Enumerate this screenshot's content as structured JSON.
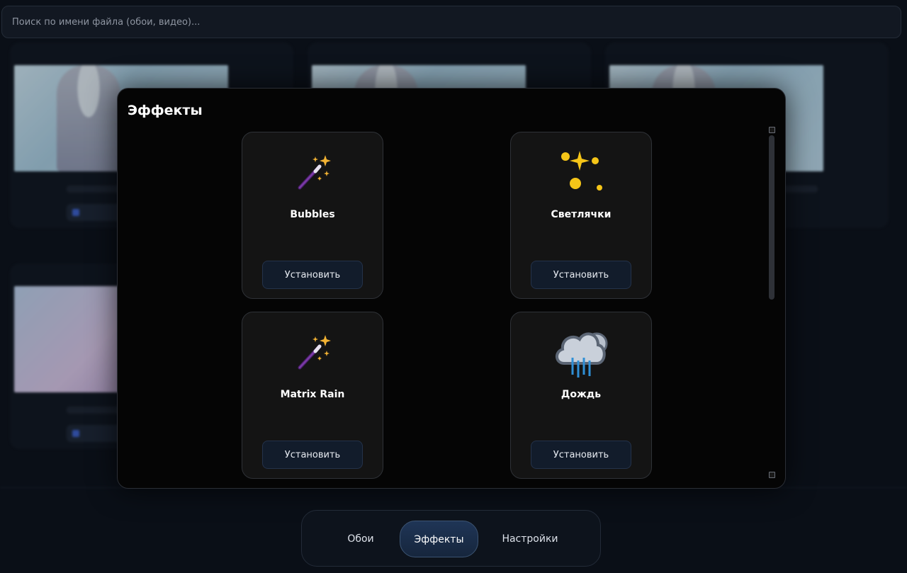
{
  "search": {
    "placeholder": "Поиск по имени файла (обои, видео)..."
  },
  "modal": {
    "title": "Эффекты",
    "effects": [
      {
        "name": "Bubbles",
        "icon": "magic-wand-icon",
        "button": "Установить"
      },
      {
        "name": "Светлячки",
        "icon": "sparkles-icon",
        "button": "Установить"
      },
      {
        "name": "Matrix Rain",
        "icon": "magic-wand-icon",
        "button": "Установить"
      },
      {
        "name": "Дождь",
        "icon": "rain-cloud-icon",
        "button": "Установить"
      }
    ]
  },
  "nav": {
    "tabs": [
      {
        "label": "Обои",
        "active": false
      },
      {
        "label": "Эффекты",
        "active": true
      },
      {
        "label": "Настройки",
        "active": false
      }
    ]
  },
  "colors": {
    "accent": "#1f3556",
    "button_bg": "#121c2b",
    "modal_bg": "#050505",
    "sparkle": "#f5c518"
  }
}
